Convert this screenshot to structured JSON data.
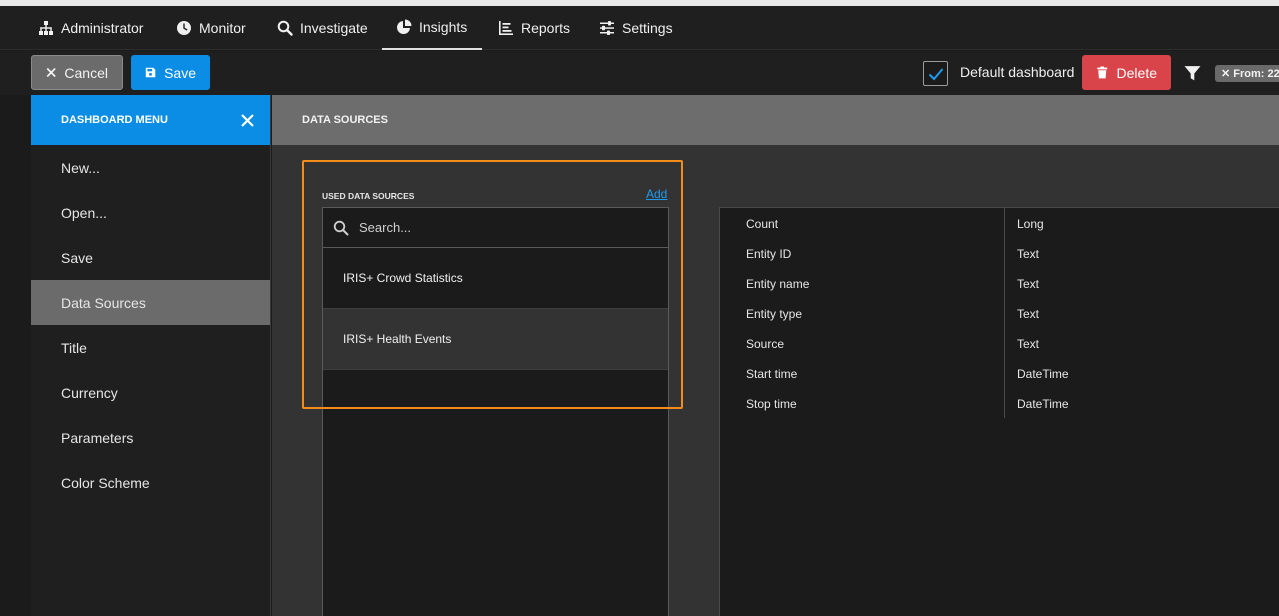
{
  "nav": {
    "items": [
      {
        "label": "Administrator",
        "icon": "sitemap-icon"
      },
      {
        "label": "Monitor",
        "icon": "clock-icon"
      },
      {
        "label": "Investigate",
        "icon": "search-icon"
      },
      {
        "label": "Insights",
        "icon": "pie-chart-icon"
      },
      {
        "label": "Reports",
        "icon": "bar-chart-icon"
      },
      {
        "label": "Settings",
        "icon": "sliders-icon"
      }
    ],
    "active": "Insights"
  },
  "toolbar": {
    "cancel_label": "Cancel",
    "save_label": "Save",
    "default_dashboard_label": "Default dashboard",
    "default_dashboard_checked": true,
    "delete_label": "Delete",
    "from_chip": "✕ From: 22"
  },
  "sidebar": {
    "title": "DASHBOARD MENU",
    "items": [
      {
        "label": "New..."
      },
      {
        "label": "Open..."
      },
      {
        "label": "Save"
      },
      {
        "label": "Data Sources"
      },
      {
        "label": "Title"
      },
      {
        "label": "Currency"
      },
      {
        "label": "Parameters"
      },
      {
        "label": "Color Scheme"
      }
    ],
    "active": "Data Sources"
  },
  "main": {
    "title": "DATA SOURCES",
    "used_label": "USED DATA SOURCES",
    "add_label": "Add",
    "search_placeholder": "Search...",
    "sources": [
      {
        "label": "IRIS+ Crowd Statistics"
      },
      {
        "label": "IRIS+ Health Events"
      }
    ],
    "selected_source": "IRIS+ Health Events",
    "fields": [
      {
        "name": "Count",
        "type": "Long"
      },
      {
        "name": "Entity ID",
        "type": "Text"
      },
      {
        "name": "Entity name",
        "type": "Text"
      },
      {
        "name": "Entity type",
        "type": "Text"
      },
      {
        "name": "Source",
        "type": "Text"
      },
      {
        "name": "Start time",
        "type": "DateTime"
      },
      {
        "name": "Stop time",
        "type": "DateTime"
      }
    ]
  },
  "colors": {
    "accent": "#0b8de6",
    "danger": "#d9444a",
    "highlight": "#f28c1b"
  }
}
